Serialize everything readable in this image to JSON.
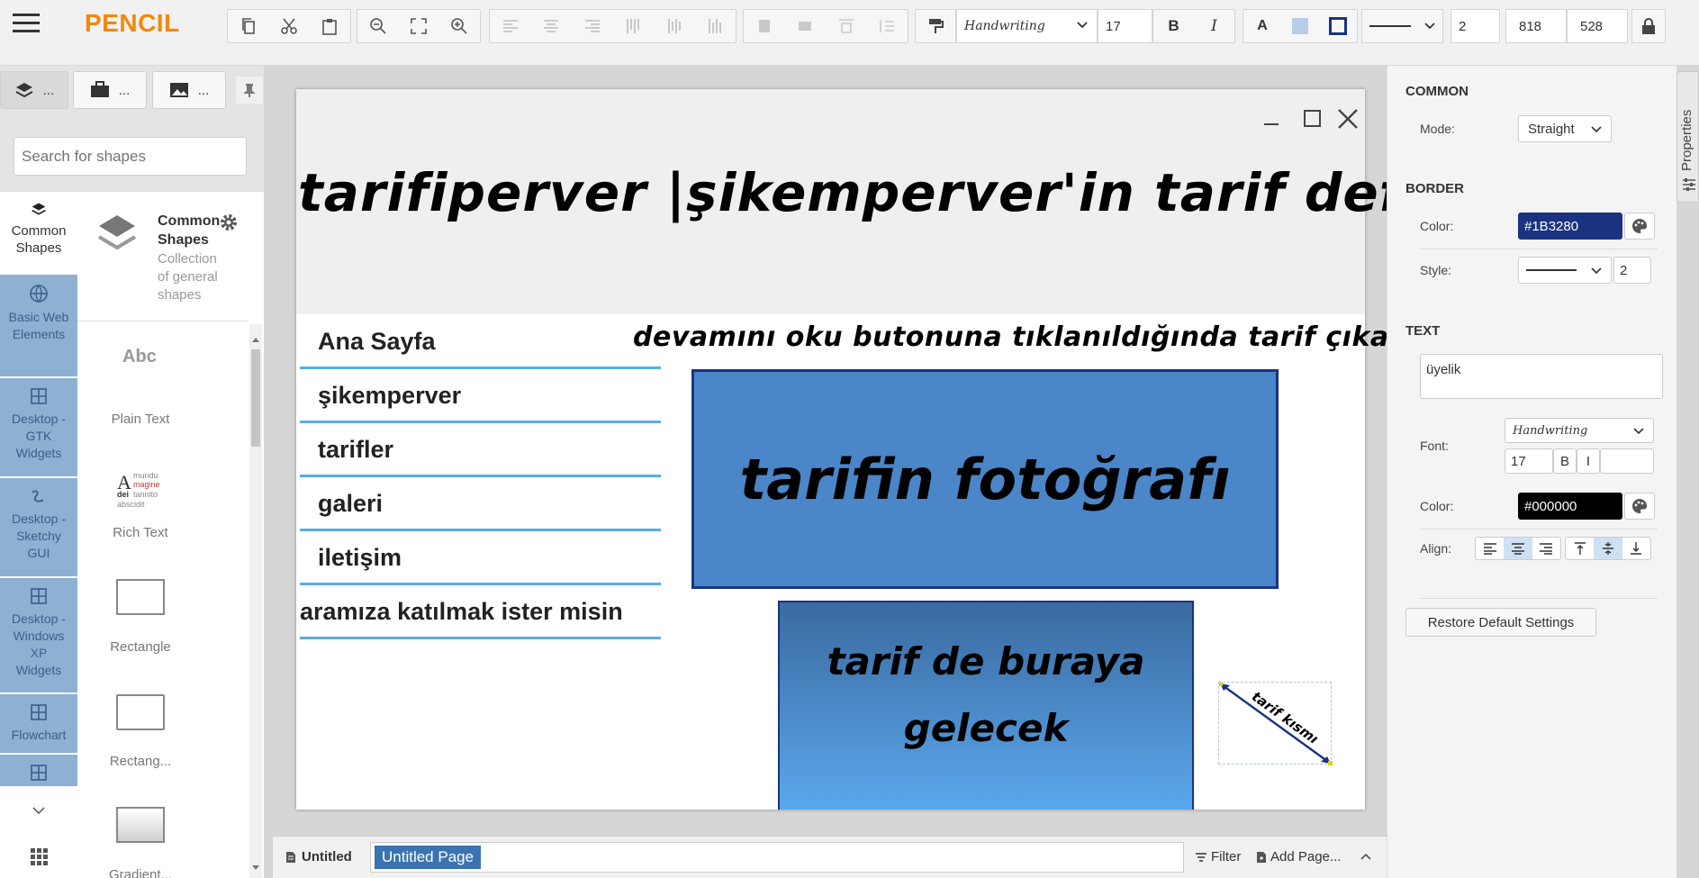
{
  "app": {
    "name": "PENCIL"
  },
  "toolbar": {
    "font_name": "Handwriting",
    "font_size": "17",
    "bold_label": "B",
    "italic_label": "I",
    "text_color_label": "A",
    "stroke_width": "2",
    "width": "818",
    "height": "528"
  },
  "left_tabs": [
    {
      "label": "..."
    },
    {
      "label": "..."
    },
    {
      "label": "..."
    }
  ],
  "search": {
    "placeholder": "Search for shapes"
  },
  "categories": [
    {
      "label": "Common Shapes"
    },
    {
      "label": "Basic Web Elements"
    },
    {
      "label": "Desktop - GTK Widgets"
    },
    {
      "label": "Desktop - Sketchy GUI"
    },
    {
      "label": "Desktop - Windows XP Widgets"
    },
    {
      "label": "Flowchart"
    }
  ],
  "collection": {
    "title": "Common Shapes",
    "desc": "Collection of general shapes"
  },
  "shapes": [
    {
      "label": "Plain Text",
      "preview": "Abc"
    },
    {
      "label": "Rich Text"
    },
    {
      "label": "Rectangle"
    },
    {
      "label": "Rectang..."
    },
    {
      "label": "Gradient..."
    }
  ],
  "page": {
    "title": "tarifiperver |şikemperver'in tarif defteri",
    "nav": [
      "Ana Sayfa",
      "şikemperver",
      "tarifler",
      "galeri",
      "iletişim",
      "aramıza katılmak ister misin"
    ],
    "notice": "devamını oku butonuna tıklanıldığında tarif çıkacak",
    "photo_label": "tarifin fotoğrafı",
    "recipe_label_1": "tarif de buraya",
    "recipe_label_2": "gelecek",
    "arrow_label": "tarif kısmı"
  },
  "properties": {
    "tab_label": "Properties",
    "common_header": "COMMON",
    "mode_label": "Mode:",
    "mode_value": "Straight",
    "border_header": "BORDER",
    "color_label": "Color:",
    "border_color": "#1B3280",
    "style_label": "Style:",
    "border_width": "2",
    "text_header": "TEXT",
    "text_value": "üyelik",
    "font_label": "Font:",
    "font_value": "Handwriting",
    "font_size": "17",
    "bold": "B",
    "italic": "I",
    "text_color_label": "Color:",
    "text_color": "#000000",
    "align_label": "Align:",
    "restore_label": "Restore Default Settings"
  },
  "bottom": {
    "page_name": "Untitled",
    "active_page": "Untitled Page",
    "filter_label": "Filter",
    "add_page_label": "Add Page..."
  },
  "colors": {
    "accent": "#f0890f",
    "selection": "#3b73b0",
    "photo_fill": "#4a86c8",
    "border_dark": "#1b3280"
  }
}
